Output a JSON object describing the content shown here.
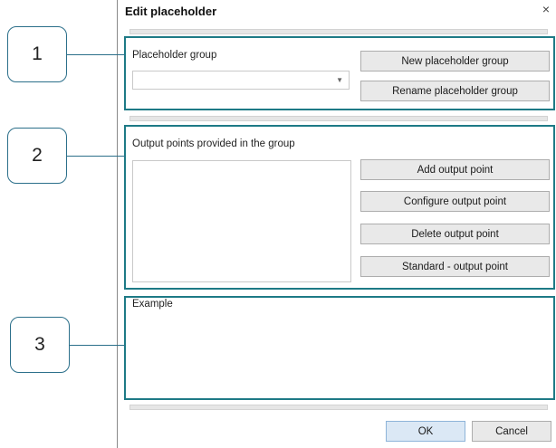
{
  "dialog": {
    "title": "Edit placeholder",
    "close_symbol": "×"
  },
  "callouts": [
    "1",
    "2",
    "3"
  ],
  "group_section": {
    "label": "Placeholder group",
    "combo_value": "",
    "new_button": "New placeholder group",
    "rename_button": "Rename placeholder group"
  },
  "output_section": {
    "label": "Output points provided in the group",
    "items": [],
    "add_button": "Add output point",
    "configure_button": "Configure output point",
    "delete_button": "Delete output point",
    "standard_button": "Standard - output point"
  },
  "example_section": {
    "label": "Example"
  },
  "footer": {
    "ok_button": "OK",
    "cancel_button": "Cancel"
  },
  "colors": {
    "highlight": "#1e7a86",
    "callout_border": "#2b6f8a",
    "ok_accent": "#dbe8f5"
  }
}
